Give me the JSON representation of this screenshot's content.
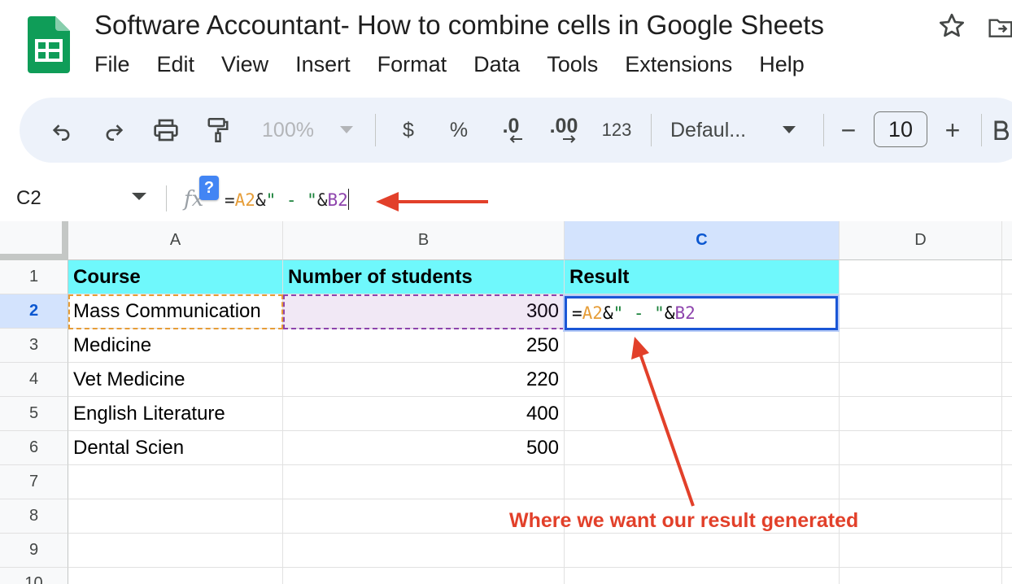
{
  "app": {
    "doc_title": "Software Accountant- How to combine cells in Google Sheets",
    "logo_icon": "google-sheets-icon"
  },
  "menu": [
    "File",
    "Edit",
    "View",
    "Insert",
    "Format",
    "Data",
    "Tools",
    "Extensions",
    "Help"
  ],
  "toolbar": {
    "zoom": "100%",
    "currency": "$",
    "percent": "%",
    "decrease_decimal": ".0",
    "increase_decimal": ".00",
    "number_format": "123",
    "font": "Defaul...",
    "decrease_size": "−",
    "font_size": "10",
    "increase_size": "+"
  },
  "formula_bar": {
    "name_box": "C2",
    "fx": "fx",
    "help": "?",
    "formula_parts": {
      "eq": "=",
      "ref_a": "A2",
      "amp1": "&",
      "string": "\" - \"",
      "amp2": "&",
      "ref_b": "B2"
    }
  },
  "columns": [
    "A",
    "B",
    "C",
    "D"
  ],
  "rows": [
    "1",
    "2",
    "3",
    "4",
    "5",
    "6",
    "7",
    "8",
    "9",
    "10"
  ],
  "sheet": {
    "headers": {
      "a": "Course",
      "b": "Number of students",
      "c": "Result"
    },
    "data": [
      {
        "course": "Mass Communication",
        "students": "300"
      },
      {
        "course": "Medicine",
        "students": "250"
      },
      {
        "course": "Vet Medicine",
        "students": "220"
      },
      {
        "course": "English Literature",
        "students": "400"
      },
      {
        "course": "Dental Scien",
        "students": "500"
      }
    ]
  },
  "annotation": {
    "text": "Where we want our result generated"
  },
  "colors": {
    "header_fill": "#6ff8fc",
    "ref_a": "#e69d38",
    "ref_b": "#8e44ad",
    "string": "#188038",
    "active_border": "#1a56d6",
    "annotation": "#e2402a"
  }
}
